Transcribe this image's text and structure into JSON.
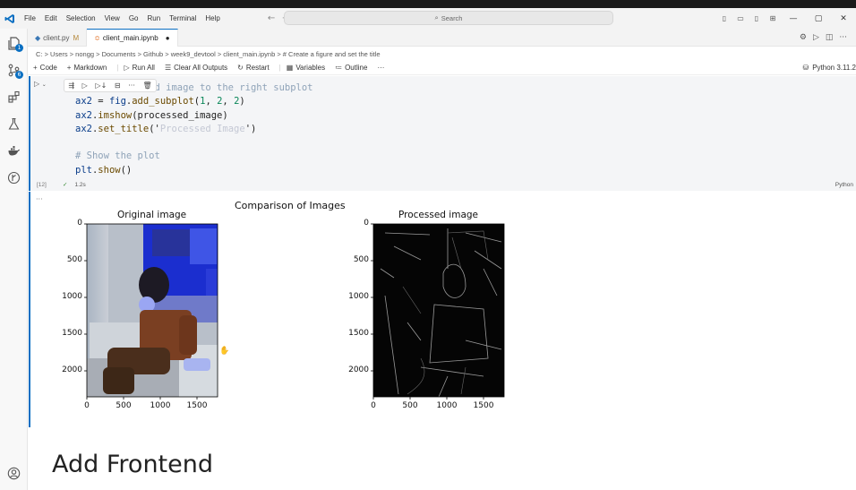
{
  "titlebar": {
    "menu": [
      "File",
      "Edit",
      "Selection",
      "View",
      "Go",
      "Run",
      "Terminal",
      "Help"
    ],
    "search_placeholder": "Search"
  },
  "tabs": [
    {
      "label": "client.py",
      "modified": "M"
    },
    {
      "label": "client_main.ipynb",
      "modified": "●"
    }
  ],
  "breadcrumb": "C: > Users > nongg > Documents > Github > week9_devtool > client_main.ipynb > # Create a figure and set the title",
  "toolbar": {
    "code": "Code",
    "markdown": "Markdown",
    "run_all": "Run All",
    "clear_outputs": "Clear All Outputs",
    "restart": "Restart",
    "variables": "Variables",
    "outline": "Outline",
    "more": "···",
    "kernel": "Python 3.11.2"
  },
  "cell": {
    "code_lines": [
      {
        "parts": [
          {
            "t": "# Add processed image to the right subplot",
            "c": "cm"
          }
        ]
      },
      {
        "parts": [
          {
            "t": "ax2",
            "c": "var"
          },
          {
            "t": " = ",
            "c": ""
          },
          {
            "t": "fig",
            "c": "var"
          },
          {
            "t": ".",
            "c": ""
          },
          {
            "t": "add_subplot",
            "c": "fn"
          },
          {
            "t": "(",
            "c": ""
          },
          {
            "t": "1",
            "c": "num"
          },
          {
            "t": ", ",
            "c": ""
          },
          {
            "t": "2",
            "c": "num"
          },
          {
            "t": ", ",
            "c": ""
          },
          {
            "t": "2",
            "c": "num"
          },
          {
            "t": ")",
            "c": ""
          }
        ]
      },
      {
        "parts": [
          {
            "t": "ax2",
            "c": "var"
          },
          {
            "t": ".",
            "c": ""
          },
          {
            "t": "imshow",
            "c": "fn"
          },
          {
            "t": "(processed_image)",
            "c": ""
          }
        ]
      },
      {
        "parts": [
          {
            "t": "ax2",
            "c": "var"
          },
          {
            "t": ".",
            "c": ""
          },
          {
            "t": "set_title",
            "c": "fn"
          },
          {
            "t": "('",
            "c": ""
          },
          {
            "t": "Processed Image",
            "c": "str"
          },
          {
            "t": "')",
            "c": ""
          }
        ]
      },
      {
        "parts": [
          {
            "t": "",
            "c": ""
          }
        ]
      },
      {
        "parts": [
          {
            "t": "# Show the plot",
            "c": "cm"
          }
        ]
      },
      {
        "parts": [
          {
            "t": "plt",
            "c": "var"
          },
          {
            "t": ".",
            "c": ""
          },
          {
            "t": "show",
            "c": "fn"
          },
          {
            "t": "()",
            "c": ""
          }
        ]
      }
    ],
    "exec_count": "[12]",
    "exec_time": "1.2s",
    "language": "Python"
  },
  "output": {
    "figure_title": "Comparison of Images",
    "left_title": "Original image",
    "right_title": "Processed image",
    "y_ticks": [
      "0",
      "500",
      "1000",
      "1500",
      "2000"
    ],
    "x_ticks": [
      "0",
      "500",
      "1000",
      "1500"
    ]
  },
  "markdown_heading": "Add Frontend",
  "colors": {
    "accent": "#0a6fc2",
    "cell_bg": "#f4f5f7"
  }
}
